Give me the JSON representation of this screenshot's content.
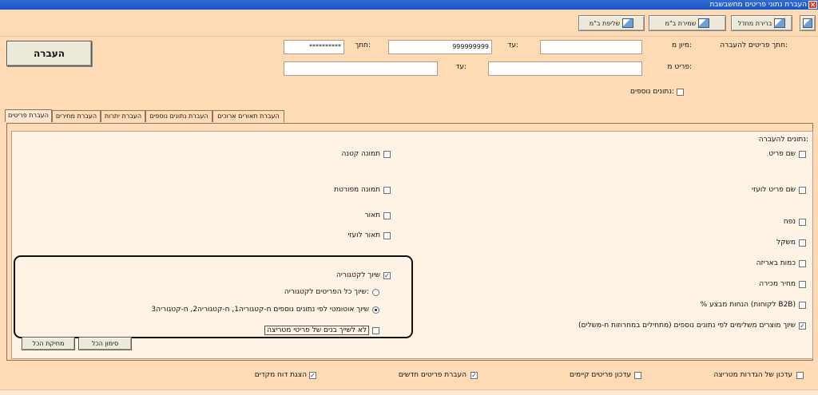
{
  "window": {
    "title": "העברת נתוני פריטים מחשבשבת"
  },
  "toolbar": {
    "buttons": [
      {
        "label": ""
      },
      {
        "label": "ברירת מחדל"
      },
      {
        "label": "שמירת ב\"מ"
      },
      {
        "label": "שליפת ב\"מ"
      }
    ]
  },
  "top": {
    "transfer_button": "העברה",
    "filter_label": "חתך פריטים להעברה:",
    "sort_label": "מיון מ:",
    "sort_to_label": "עד:",
    "sort_from_value": "",
    "sort_to_value": "999999999",
    "cut_label": "חתך:",
    "cut_value": "**********",
    "items_from_label": "פריט מ:",
    "items_to_label": "עד:",
    "items_from_value": "",
    "items_to_value": "",
    "additional_data_label": "נתונים נוספים:"
  },
  "tabs": [
    {
      "label": "העברת פריטים",
      "active": true
    },
    {
      "label": "העברת מחירים",
      "active": false
    },
    {
      "label": "העברת יתרות",
      "active": false
    },
    {
      "label": "העברת נתונים נוספים",
      "active": false
    },
    {
      "label": "העברת תאורים ארוכים",
      "active": false
    }
  ],
  "panel": {
    "section_title": "נתונים להעברה:",
    "right_options": [
      {
        "label": "שם פריט",
        "checked": false
      },
      {
        "label": "שם פריט לועזי",
        "checked": false
      },
      {
        "label": "נפח",
        "checked": false
      },
      {
        "label": "משקל",
        "checked": false
      },
      {
        "label": "כמות באריזה",
        "checked": false
      },
      {
        "label": "מחיר מכירה",
        "checked": false
      },
      {
        "label": "% הנחות מבצע (לקוחות B2B)",
        "checked": false
      },
      {
        "label": "שיוך מוצרים משלימים לפי נתונים נוספים (מתחילים במחרוזות ח-משלים)",
        "checked": true
      }
    ],
    "left_options": [
      {
        "label": "תמונה קטנה",
        "checked": false
      },
      {
        "label": "תמונה מפורטת",
        "checked": false
      },
      {
        "label": "תאור",
        "checked": false
      },
      {
        "label": "תאור לועזי",
        "checked": false
      }
    ],
    "category": {
      "assign_label": "שיוך לקטגוריה",
      "assign_checked": true,
      "radio_all_label": "שיוך כל הפריטים לקטגוריה:",
      "radio_all_selected": false,
      "radio_auto_label": "שיוך אוטומטי לפי נתונים נוספים ח-קטגוריה1, ח-קטגוריה2, ח-קטגוריה3",
      "radio_auto_selected": true,
      "no_children_label": "לא לשייך בנים של פריטי מטריצה",
      "no_children_checked": false
    },
    "select_all_label": "סימון הכל",
    "clear_all_label": "מחיקת הכל"
  },
  "bottom": [
    {
      "label": "עדכון של הגדרות מטריצה",
      "checked": false
    },
    {
      "label": "עדכון פריטים קיימים",
      "checked": false
    },
    {
      "label": "העברת פריטים חדשים",
      "checked": true
    },
    {
      "label": "הצגת דוח מקדים",
      "checked": true
    }
  ]
}
